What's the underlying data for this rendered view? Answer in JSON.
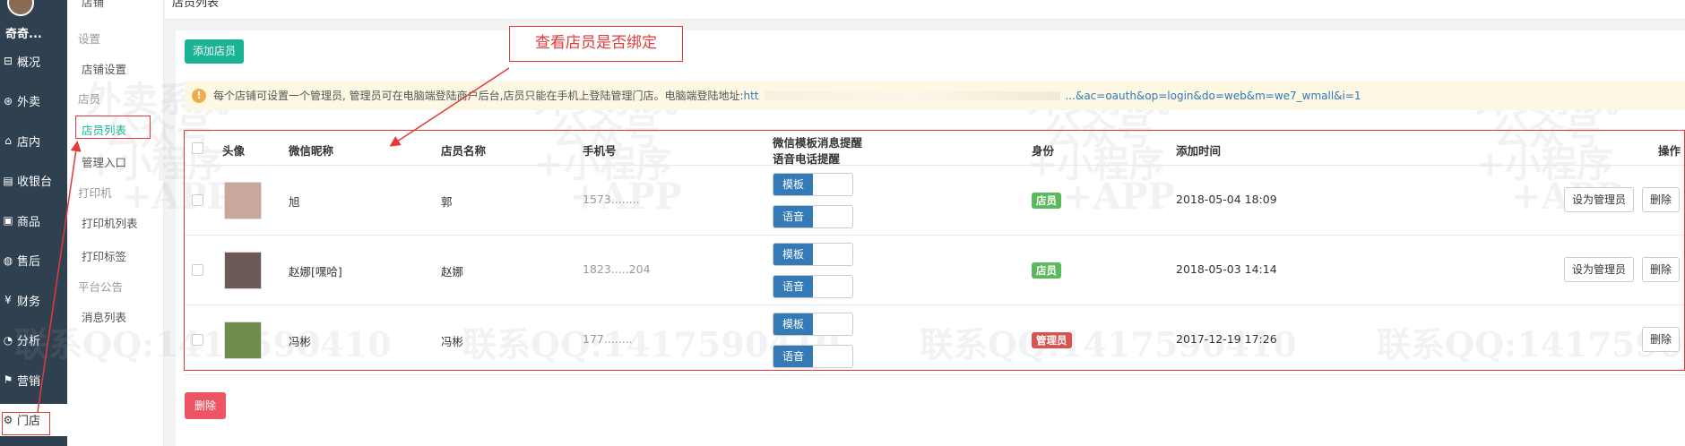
{
  "nav": {
    "user_name": "奇奇...",
    "items": [
      {
        "icon": "overview-icon",
        "glyph": "⊟",
        "label": "概况"
      },
      {
        "icon": "delivery-icon",
        "glyph": "⊛",
        "label": "外卖"
      },
      {
        "icon": "dine-in-icon",
        "glyph": "⌂",
        "label": "店内"
      },
      {
        "icon": "cashier-icon",
        "glyph": "▤",
        "label": "收银台"
      },
      {
        "icon": "goods-icon",
        "glyph": "▣",
        "label": "商品"
      },
      {
        "icon": "after-sales-icon",
        "glyph": "◍",
        "label": "售后"
      },
      {
        "icon": "finance-icon",
        "glyph": "¥",
        "label": "财务"
      },
      {
        "icon": "analysis-icon",
        "glyph": "◔",
        "label": "分析"
      },
      {
        "icon": "marketing-icon",
        "glyph": "⚑",
        "label": "营销"
      },
      {
        "icon": "store-gear-icon",
        "glyph": "⚙",
        "label": "门店"
      }
    ]
  },
  "subnav": {
    "top_label": "店铺",
    "group_settings": "设置",
    "store_settings": "店铺设置",
    "group_clerk": "店员",
    "clerk_list": "店员列表",
    "admin_entry": "管理入口",
    "group_print": "打印机",
    "printer_list": "打印机列表",
    "print_label": "打印标签",
    "group_notice": "平台公告",
    "message_list": "消息列表"
  },
  "header": {
    "title": "店员列表"
  },
  "callout": "查看店员是否绑定",
  "main": {
    "add_button": "添加店员",
    "tip_text": "每个店铺可设置一个管理员, 管理员可在电脑端登陆商户后台,店员只能在手机上登陆管理门店。电脑端登陆地址:",
    "tip_link_start": "htt",
    "tip_link_end": "...&ac=oauth&op=login&do=web&m=we7_wmall&i=1",
    "delete_button": "删除"
  },
  "table": {
    "headers": {
      "avatar": "头像",
      "wechat_nick": "微信昵称",
      "clerk_name": "店员名称",
      "phone": "手机号",
      "notify_line1": "微信模板消息提醒",
      "notify_line2": "语音电话提醒",
      "role": "身份",
      "added_time": "添加时间",
      "actions": "操作"
    },
    "rows": [
      {
        "nick": "旭",
        "name": "郭",
        "phone": "1573........",
        "template": "模板",
        "voice": "语音",
        "role": "店员",
        "role_type": "staff",
        "time": "2018-05-04 18:09",
        "set_admin": "设为管理员",
        "delete": "删除",
        "avatar_color": "#c9a79a"
      },
      {
        "nick": "赵娜[嘿哈]",
        "name": "赵娜",
        "phone": "1823.....204",
        "template": "模板",
        "voice": "语音",
        "role": "店员",
        "role_type": "staff",
        "time": "2018-05-03 14:14",
        "set_admin": "设为管理员",
        "delete": "删除",
        "avatar_color": "#6b5a55"
      },
      {
        "nick": "冯彬",
        "name": "冯彬",
        "phone": "177........",
        "template": "模板",
        "voice": "语音",
        "role": "管理员",
        "role_type": "admin",
        "time": "2017-12-19 17:26",
        "delete": "删除",
        "avatar_color": "#6e8c4a"
      }
    ]
  },
  "watermark": {
    "line1": "外卖系统",
    "line2": "公众号",
    "line3": "+小程序",
    "line4": "+APP",
    "contact": "联系QQ:1417590410"
  },
  "colors": {
    "accent": "#1ab394",
    "nav_bg": "#2f4050",
    "primary": "#337ab7",
    "danger": "#ed5565",
    "annotation": "#e23a3a"
  }
}
